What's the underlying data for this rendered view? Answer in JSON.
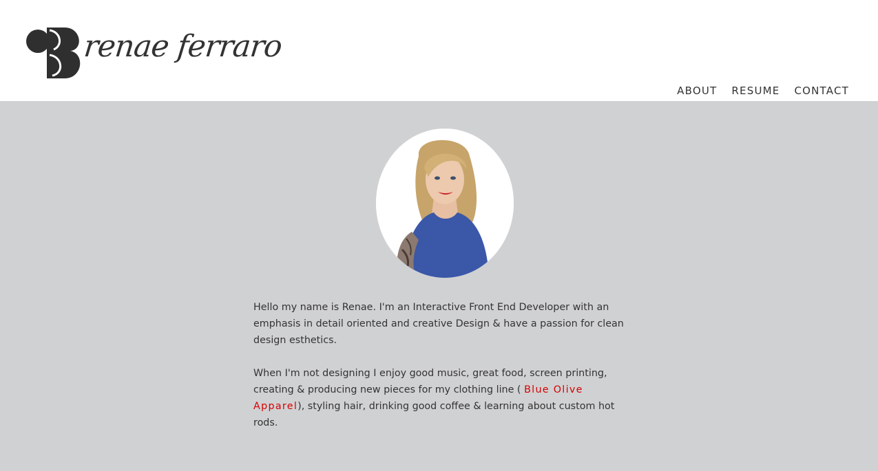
{
  "header": {
    "logo_text": "renae ferraro"
  },
  "nav": {
    "items": [
      "ABOUT",
      "RESUME",
      "CONTACT"
    ]
  },
  "bio": {
    "paragraph_1": "Hello my name is Renae. I'm an Interactive Front End Developer with an emphasis in detail oriented and creative Design & have a passion for clean design esthetics.",
    "paragraph_2_before": "When I'm not designing I enjoy good music, great food, screen printing, creating & producing new pieces for my clothing line ( ",
    "paragraph_2_link": "Blue Olive Apparel",
    "paragraph_2_after": "), styling hair, drinking good coffee & learning about custom hot rods."
  },
  "colors": {
    "background": "#d0d1d3",
    "header": "#ffffff",
    "text": "#333333",
    "link": "#d50000",
    "dress": "#3a57a8"
  }
}
